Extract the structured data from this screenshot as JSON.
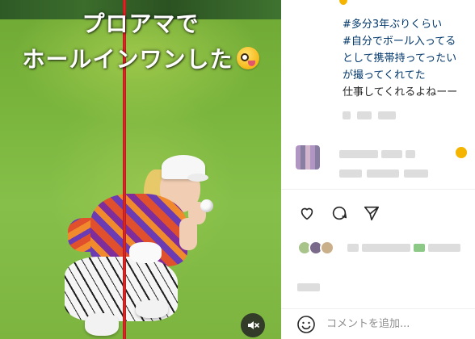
{
  "video": {
    "caption_line1": "プロアマで",
    "caption_line2": "ホールインワンした",
    "caption_emoji_icon": "zany-face-emoji-icon",
    "mute_icon": "speaker-muted-icon"
  },
  "post": {
    "caption_lines": [
      "#多分3年ぶりくらい",
      "#自分でボール入ってる",
      "として携帯持ってったい",
      "が撮ってくれてた",
      "仕事してくれるよねーー"
    ]
  },
  "actions": {
    "like_icon": "heart-icon",
    "comment_icon": "comment-bubble-icon",
    "share_icon": "paper-plane-icon"
  },
  "comment_bar": {
    "emoji_icon": "smiley-icon",
    "placeholder": "コメントを追加..."
  },
  "colors": {
    "hashtag": "#00376b",
    "text": "#262626",
    "muted": "#8e8e8e",
    "flagstick": "#e22a2a"
  }
}
